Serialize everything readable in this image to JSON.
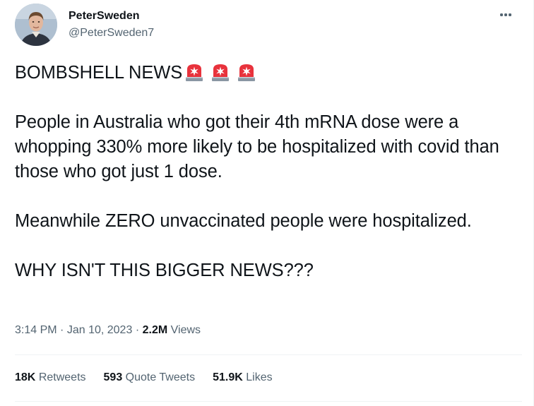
{
  "author": {
    "name": "PeterSweden",
    "handle": "@PeterSweden7"
  },
  "tweet": {
    "headline": "BOMBSHELL NEWS",
    "headline_icons": [
      "police-car-light-icon",
      "police-car-light-icon",
      "police-car-light-icon"
    ],
    "paragraph_1": "People in Australia who got their 4th mRNA dose were a whopping 330% more likely to be hospitalized with covid than those who got just 1 dose.",
    "paragraph_2": "Meanwhile ZERO unvaccinated people were hospitalized.",
    "paragraph_3": "WHY ISN'T THIS BIGGER NEWS???"
  },
  "meta": {
    "time": "3:14 PM",
    "separator": "·",
    "date": "Jan 10, 2023",
    "views_count": "2.2M",
    "views_label": "Views"
  },
  "stats": {
    "retweets_count": "18K",
    "retweets_label": "Retweets",
    "quotes_count": "593",
    "quotes_label": "Quote Tweets",
    "likes_count": "51.9K",
    "likes_label": "Likes"
  },
  "colors": {
    "primary_text": "#0f1419",
    "secondary_text": "#536471",
    "divider": "#eff3f4",
    "siren_red": "#e8323c"
  }
}
